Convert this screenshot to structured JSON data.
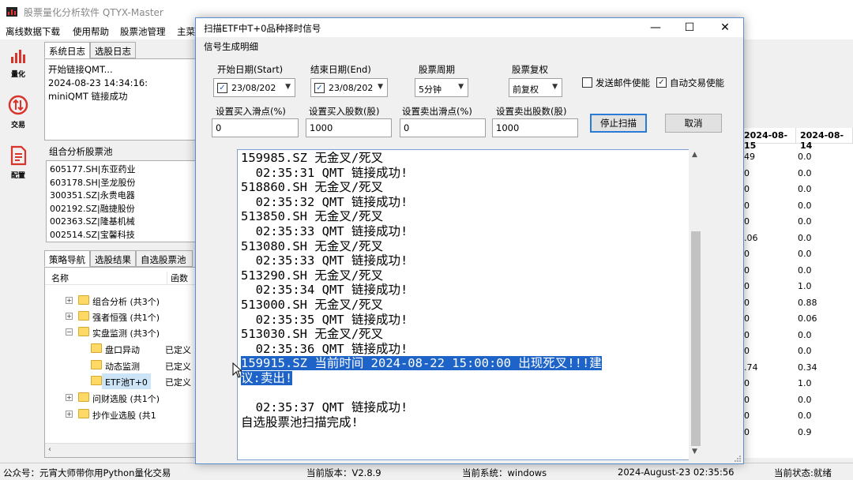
{
  "main_window": {
    "title": "股票量化分析软件 QTYX-Master"
  },
  "menu": [
    "离线数据下载",
    "使用帮助",
    "股票池管理",
    "主菜"
  ],
  "toolbar": [
    {
      "icon": "bar-chart-icon",
      "label": "量化"
    },
    {
      "icon": "trade-arrows-icon",
      "label": "交易"
    },
    {
      "icon": "config-doc-icon",
      "label": "配置"
    }
  ],
  "log_tabs": [
    "系统日志",
    "选股日志"
  ],
  "system_log": [
    "开始链接QMT...",
    "2024-08-23 14:34:16:",
    "miniQMT 链接成功"
  ],
  "stock_pool": {
    "label": "组合分析股票池",
    "items": [
      "605177.SH|东亚药业",
      "603178.SH|圣龙股份",
      "300351.SZ|永贵电器",
      "002192.SZ|融捷股份",
      "002363.SZ|隆基机械",
      "002514.SZ|宝馨科技"
    ]
  },
  "strategy_tabs": [
    "策略导航",
    "选股结果",
    "自选股票池"
  ],
  "tree": {
    "headers": [
      "名称",
      "函数"
    ],
    "rows": [
      {
        "label": "组合分析 (共3个)",
        "func": "",
        "expander": "+"
      },
      {
        "label": "强者恒强 (共1个)",
        "func": "",
        "expander": "+"
      },
      {
        "label": "实盘监测 (共3个)",
        "func": "",
        "expander": "−"
      },
      {
        "label": "盘口异动",
        "func": "已定义",
        "expander": ""
      },
      {
        "label": "动态监测",
        "func": "已定义",
        "expander": ""
      },
      {
        "label": "ETF池T+0",
        "func": "已定义",
        "expander": ""
      },
      {
        "label": "问财选股 (共1个)",
        "func": "",
        "expander": "+"
      },
      {
        "label": "抄作业选股 (共1",
        "func": "",
        "expander": "+"
      }
    ]
  },
  "right_table": {
    "headers": [
      "2024-08-15",
      "2024-08-14"
    ],
    "rows": [
      [
        "49",
        "0.0"
      ],
      [
        "0",
        "0.0"
      ],
      [
        "0",
        "0.0"
      ],
      [
        "0",
        "0.0"
      ],
      [
        "0",
        "0.0"
      ],
      [
        ".06",
        "0.0"
      ],
      [
        "0",
        "0.0"
      ],
      [
        "0",
        "0.0"
      ],
      [
        "0",
        "1.0"
      ],
      [
        "0",
        "0.88"
      ],
      [
        "0",
        "0.06"
      ],
      [
        "0",
        "0.0"
      ],
      [
        "0",
        "0.0"
      ],
      [
        ".74",
        "0.34"
      ],
      [
        "0",
        "1.0"
      ],
      [
        "0",
        "0.0"
      ],
      [
        "0",
        "0.0"
      ],
      [
        "0",
        "0.9"
      ]
    ]
  },
  "status_bar": {
    "public_account": "公众号：元宵大师带你用Python量化交易",
    "version": "当前版本：V2.8.9",
    "system": "当前系统：windows",
    "datetime": "2024-August-23 02:35:56",
    "state": "当前状态:就绪"
  },
  "dialog": {
    "title": "扫描ETF中T+0品种择时信号",
    "window_controls": [
      "—",
      "☐",
      "✕"
    ],
    "group_label": "信号生成明细",
    "fields": {
      "start_date": {
        "label": "开始日期(Start)",
        "value": "23/08/202",
        "checked": "✓"
      },
      "end_date": {
        "label": "结束日期(End)",
        "value": "23/08/202",
        "checked": "✓"
      },
      "period": {
        "label": "股票周期",
        "value": "5分钟"
      },
      "adjust": {
        "label": "股票复权",
        "value": "前复权"
      },
      "buy_slippage": {
        "label": "设置买入滑点(%)",
        "value": "0"
      },
      "buy_shares": {
        "label": "设置买入股数(股)",
        "value": "1000"
      },
      "sell_slippage": {
        "label": "设置卖出滑点(%)",
        "value": "0"
      },
      "sell_shares": {
        "label": "设置卖出股数(股)",
        "value": "1000"
      }
    },
    "email_check": {
      "label": "发送邮件使能",
      "checked": ""
    },
    "auto_trade_check": {
      "label": "自动交易使能",
      "checked": "✓"
    },
    "stop_button": "停止扫描",
    "cancel_button": "取消",
    "output_lines": [
      "159985.SZ 无金叉/死叉",
      "  02:35:31 QMT 链接成功!",
      "518860.SH 无金叉/死叉",
      "  02:35:32 QMT 链接成功!",
      "513850.SH 无金叉/死叉",
      "  02:35:33 QMT 链接成功!",
      "513080.SH 无金叉/死叉",
      "  02:35:33 QMT 链接成功!",
      "513290.SH 无金叉/死叉",
      "  02:35:34 QMT 链接成功!",
      "513000.SH 无金叉/死叉",
      "  02:35:35 QMT 链接成功!",
      "513030.SH 无金叉/死叉",
      "  02:35:36 QMT 链接成功!"
    ],
    "highlight_lines": [
      "159915.SZ 当前时间 2024-08-22 15:00:00 出现死叉!!!建",
      "议:卖出!"
    ],
    "tail_lines": [
      "",
      "  02:35:37 QMT 链接成功!",
      "自选股票池扫描完成!"
    ]
  }
}
